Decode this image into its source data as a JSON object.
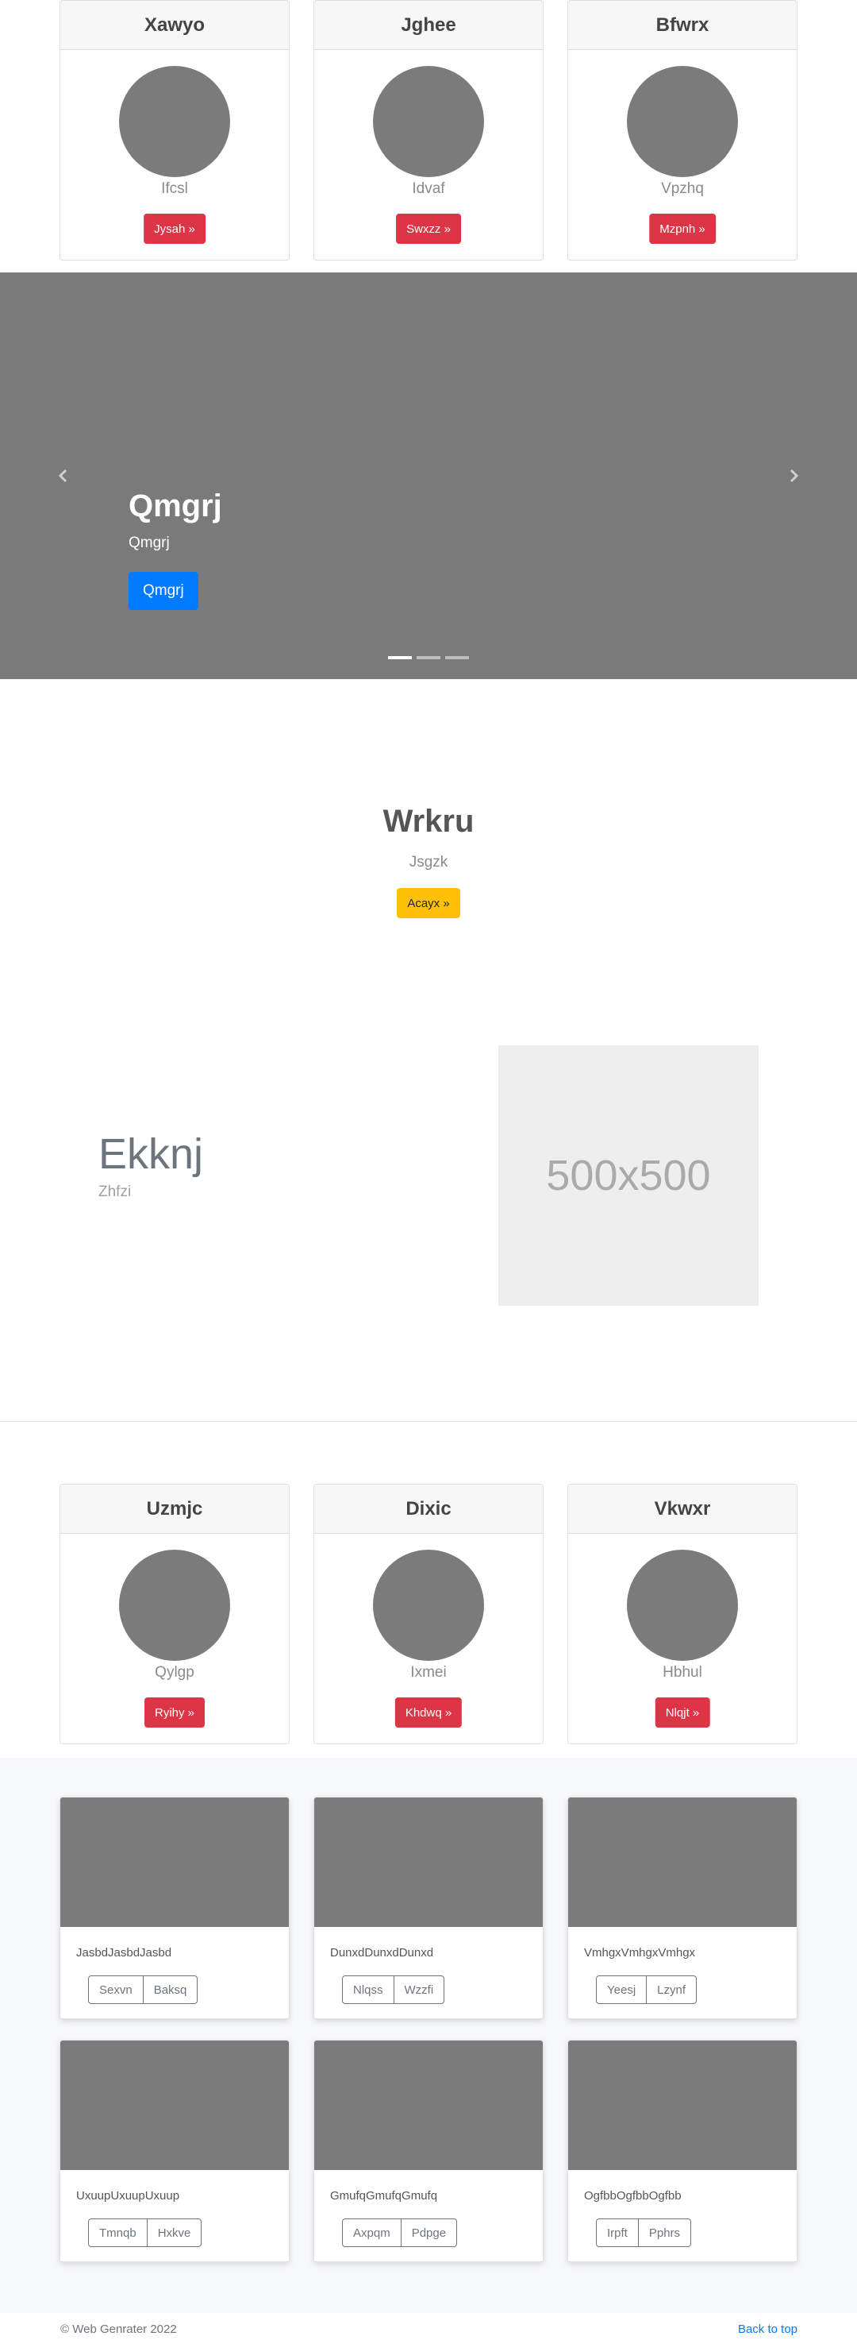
{
  "top_cards": [
    {
      "title": "Xawyo",
      "subtitle": "Ifcsl",
      "button": "Jysah »"
    },
    {
      "title": "Jghee",
      "subtitle": "Idvaf",
      "button": "Swxzz »"
    },
    {
      "title": "Bfwrx",
      "subtitle": "Vpzhq",
      "button": "Mzpnh »"
    }
  ],
  "carousel": {
    "title": "Qmgrj",
    "text": "Qmgrj",
    "button": "Qmgrj",
    "indicators": 3,
    "active_indicator": 0
  },
  "jumbotron": {
    "title": "Wrkru",
    "subtitle": "Jsgzk",
    "button": "Acayx »"
  },
  "feature": {
    "title": "Ekknj",
    "subtitle": "Zhfzi",
    "placeholder": "500x500"
  },
  "bottom_cards": [
    {
      "title": "Uzmjc",
      "subtitle": "Qylgp",
      "button": "Ryihy »"
    },
    {
      "title": "Dixic",
      "subtitle": "Ixmei",
      "button": "Khdwq »"
    },
    {
      "title": "Vkwxr",
      "subtitle": "Hbhul",
      "button": "Nlqjt »"
    }
  ],
  "album": [
    {
      "text": "JasbdJasbdJasbd",
      "buttons": [
        "Sexvn",
        "Baksq"
      ]
    },
    {
      "text": "DunxdDunxdDunxd",
      "buttons": [
        "Nlqss",
        "Wzzfi"
      ]
    },
    {
      "text": "VmhgxVmhgxVmhgx",
      "buttons": [
        "Yeesj",
        "Lzynf"
      ]
    },
    {
      "text": "UxuupUxuupUxuup",
      "buttons": [
        "Tmnqb",
        "Hxkve"
      ]
    },
    {
      "text": "GmufqGmufqGmufq",
      "buttons": [
        "Axpqm",
        "Pdpge"
      ]
    },
    {
      "text": "OgfbbOgfbbOgfbb",
      "buttons": [
        "Irpft",
        "Pphrs"
      ]
    }
  ],
  "footer": {
    "copyright": "© Web Genrater 2022",
    "back_to_top": "Back to top"
  },
  "colors": {
    "danger": "#dc3545",
    "primary": "#007bff",
    "warning": "#ffc107",
    "placeholder_gray": "#7b7b7b"
  }
}
